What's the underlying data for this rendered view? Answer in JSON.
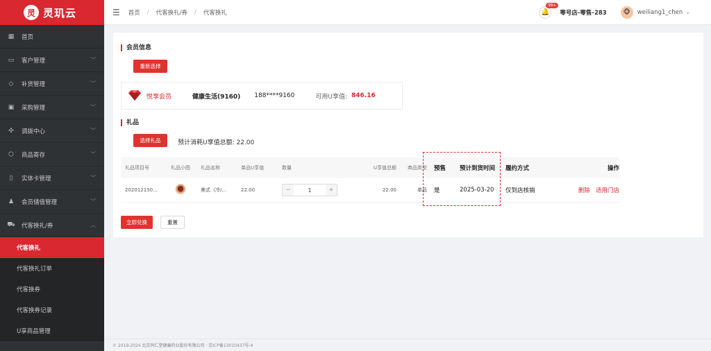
{
  "app": {
    "logo_mark": "灵",
    "name": "灵玑云"
  },
  "sidebar": {
    "items": [
      {
        "label": "首页",
        "icon": "grid-icon",
        "glyph": "▦",
        "chevron": false
      },
      {
        "label": "客户管理",
        "icon": "customer-icon",
        "glyph": "▭",
        "chevron": true
      },
      {
        "label": "补货管理",
        "icon": "diamond-icon",
        "glyph": "◇",
        "chevron": true
      },
      {
        "label": "采购管理",
        "icon": "purchase-icon",
        "glyph": "▣",
        "chevron": true
      },
      {
        "label": "调拨中心",
        "icon": "transfer-icon",
        "glyph": "✣",
        "chevron": true
      },
      {
        "label": "商品寄存",
        "icon": "box-icon",
        "glyph": "⬡",
        "chevron": true
      },
      {
        "label": "实体卡管理",
        "icon": "book-icon",
        "glyph": "▯",
        "chevron": true
      },
      {
        "label": "会员储值管理",
        "icon": "members-icon",
        "glyph": "♟",
        "chevron": true
      },
      {
        "label": "代客换礼/券",
        "icon": "cart-icon",
        "glyph": "⛟",
        "chevron": true,
        "expanded": true
      }
    ],
    "subitems": [
      {
        "label": "代客换礼",
        "active": true
      },
      {
        "label": "代客换礼订单",
        "active": false
      },
      {
        "label": "代客换券",
        "active": false
      },
      {
        "label": "代客换券记录",
        "active": false
      },
      {
        "label": "U享商品管理",
        "active": false
      }
    ]
  },
  "header": {
    "breadcrumb": [
      "首页",
      "代客换礼/券",
      "代客换礼"
    ],
    "badge": "99+",
    "store": "零号店-零售-283",
    "user": "weiliang1_chen"
  },
  "member": {
    "section_title": "会员信息",
    "reselect_button": "重新选择",
    "level": "悦享会员",
    "name": "健康生活(9160)",
    "phone": "188****9160",
    "balance_label": "可用U享值:",
    "balance": "846.16"
  },
  "gifts": {
    "section_title": "礼品",
    "select_button": "选择礼品",
    "total_label": "预计消耗U享值总额: 22.00",
    "columns": [
      "礼品项目号",
      "礼品小图",
      "礼品名称",
      "单品U享值",
      "数量",
      "U享值总额",
      "商品类型",
      "预售",
      "预计到货时间",
      "履约方式",
      "操作"
    ],
    "rows": [
      {
        "code": "202012150...",
        "name": "美式（冷/...",
        "unit_value": "22.00",
        "qty": "1",
        "minus": "−",
        "plus": "+",
        "total_value": "22.00",
        "type": "单品",
        "presale": "是",
        "arrival": "2025-03-20",
        "fulfillment": "仅到店核销",
        "op_delete": "删除",
        "op_store": "适用门店"
      }
    ]
  },
  "actions": {
    "exchange": "立即兑换",
    "reset": "重置"
  },
  "footer": {
    "text": "© 2019-2024 北京同仁堂健康药业股份有限公司 · 京ICP备13010437号-4"
  },
  "colors": {
    "accent": "#d9282f",
    "sidebar_bg": "#2f3235"
  }
}
